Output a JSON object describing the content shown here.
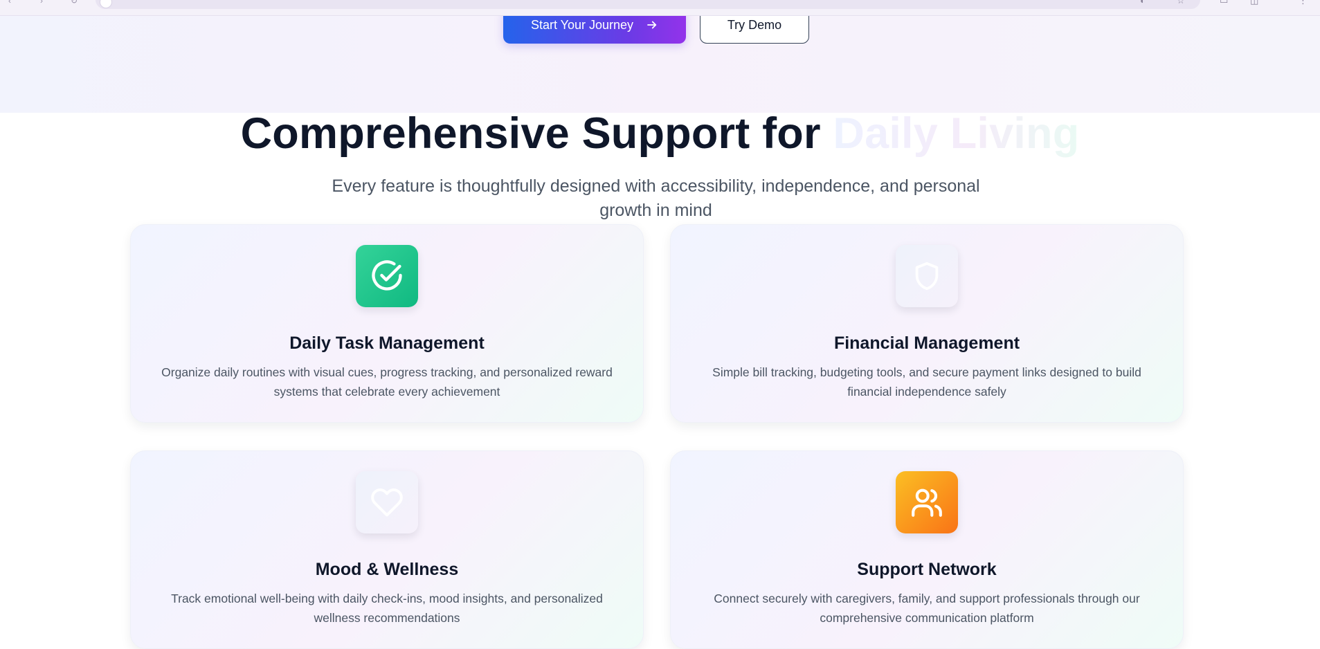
{
  "hero": {
    "primary_button": "Start Your Journey",
    "primary_icon": "arrow-right-icon",
    "secondary_button": "Try Demo"
  },
  "features_section": {
    "title_main": "Comprehensive Support for ",
    "title_accent": "Daily Living",
    "subtitle": "Every feature is thoughtfully designed with accessibility, independence, and personal growth in mind",
    "cards": [
      {
        "icon": "check-circle-icon",
        "title": "Daily Task Management",
        "description": "Organize daily routines with visual cues, progress tracking, and personalized reward systems that celebrate every achievement"
      },
      {
        "icon": "shield-icon",
        "title": "Financial Management",
        "description": "Simple bill tracking, budgeting tools, and secure payment links designed to build financial independence safely"
      },
      {
        "icon": "heart-icon",
        "title": "Mood & Wellness",
        "description": "Track emotional well-being with daily check-ins, mood insights, and personalized wellness recommendations"
      },
      {
        "icon": "users-icon",
        "title": "Support Network",
        "description": "Connect securely with caregivers, family, and support professionals through our comprehensive communication platform"
      }
    ]
  },
  "colors": {
    "primary_gradient_start": "#2563eb",
    "primary_gradient_end": "#9333ea",
    "heading": "#0f172a",
    "body_text": "#4b5563",
    "green_icon": "#10b981",
    "orange_icon": "#f97316"
  }
}
